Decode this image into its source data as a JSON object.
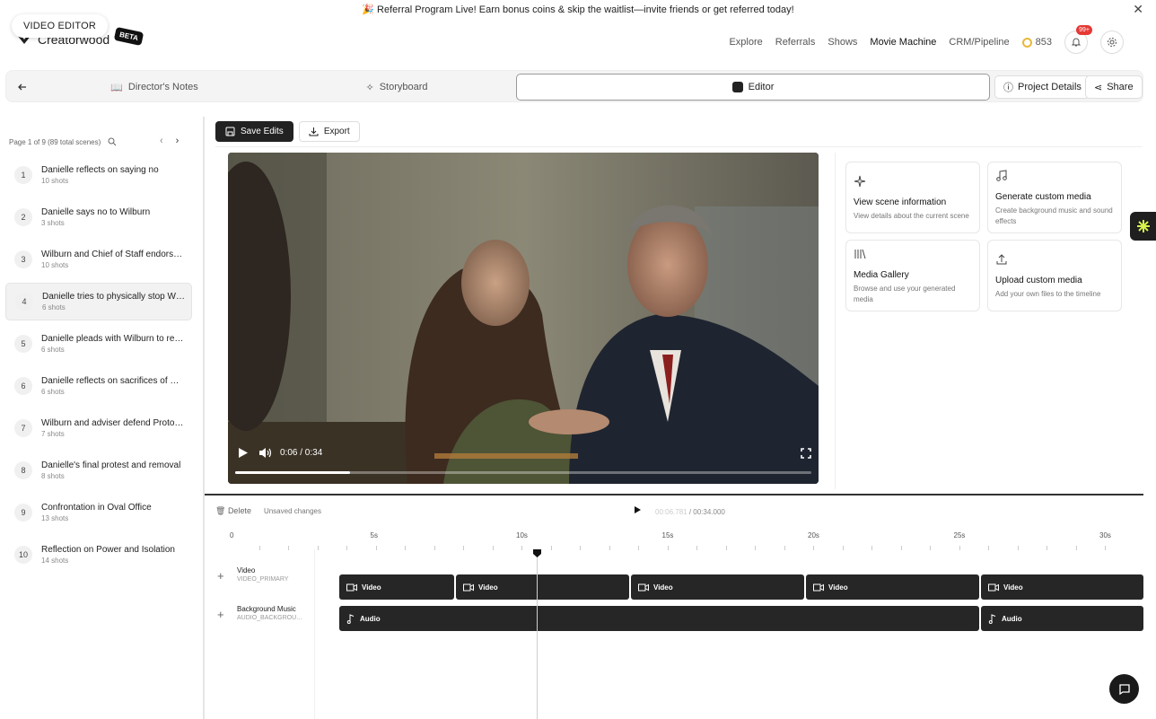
{
  "banner": {
    "text": "🎉 Referral Program Live! Earn bonus coins & skip the waitlist—invite friends or get referred today!",
    "close": "✕"
  },
  "tooltip": "VIDEO EDITOR",
  "brand": {
    "name": "Creatorwood",
    "badge": "BETA"
  },
  "nav": {
    "items": [
      "Explore",
      "Referrals",
      "Shows",
      "Movie Machine",
      "CRM/Pipeline"
    ],
    "coins": "853",
    "notifications": "99+"
  },
  "tabs": {
    "directors_notes": "Director's Notes",
    "storyboard": "Storyboard",
    "editor": "Editor",
    "project_details": "Project Details",
    "share": "Share"
  },
  "sidebar": {
    "pager": "Page 1 of 9 (89 total scenes)",
    "scenes": [
      {
        "num": "1",
        "title": "Danielle reflects on saying no",
        "shots": "10 shots"
      },
      {
        "num": "2",
        "title": "Danielle says no to Wilburn",
        "shots": "3 shots"
      },
      {
        "num": "3",
        "title": "Wilburn and Chief of Staff endorse ...",
        "shots": "10 shots"
      },
      {
        "num": "4",
        "title": "Danielle tries to physically stop Wilb...",
        "shots": "6 shots"
      },
      {
        "num": "5",
        "title": "Danielle pleads with Wilburn to reco...",
        "shots": "6 shots"
      },
      {
        "num": "6",
        "title": "Danielle reflects on sacrifices of Wil...",
        "shots": "6 shots"
      },
      {
        "num": "7",
        "title": "Wilburn and adviser defend Protoco...",
        "shots": "7 shots"
      },
      {
        "num": "8",
        "title": "Danielle's final protest and removal",
        "shots": "8 shots"
      },
      {
        "num": "9",
        "title": "Confrontation in Oval Office",
        "shots": "13 shots"
      },
      {
        "num": "10",
        "title": "Reflection on Power and Isolation",
        "shots": "14 shots"
      }
    ],
    "selected_index": 3
  },
  "toolbar": {
    "save": "Save Edits",
    "export": "Export"
  },
  "player": {
    "time": "0:06 / 0:34",
    "progress": 0.2
  },
  "cards": [
    {
      "title": "View scene information",
      "desc": "View details about the current scene",
      "icon": "sparkle-icon"
    },
    {
      "title": "Generate custom media",
      "desc": "Create background music and sound effects",
      "icon": "music-note-icon"
    },
    {
      "title": "Media Gallery",
      "desc": "Browse and use your generated media",
      "icon": "library-icon"
    },
    {
      "title": "Upload custom media",
      "desc": "Add your own files to the timeline",
      "icon": "upload-icon"
    }
  ],
  "timeline": {
    "delete": "Delete",
    "status": "Unsaved changes",
    "current_time": "00:06.781",
    "total_time": "/ 00:34.000",
    "ruler": [
      "0",
      "5s",
      "10s",
      "15s",
      "20s",
      "25s",
      "30s"
    ],
    "tracks": [
      {
        "name": "Video",
        "id": "VIDEO_PRIMARY"
      },
      {
        "name": "Background Music",
        "id": "AUDIO_BACKGROUND"
      }
    ],
    "video_clip_label": "Video",
    "audio_clip_label": "Audio"
  }
}
